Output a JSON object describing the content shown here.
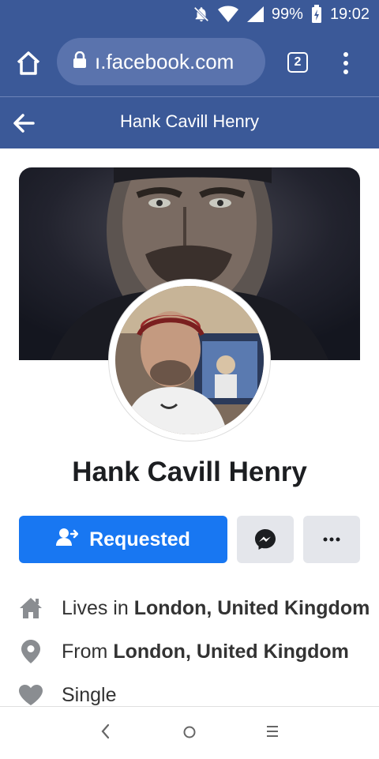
{
  "status": {
    "battery": "99%",
    "time": "19:02"
  },
  "browser": {
    "url": "ı.facebook.com",
    "tab_count": "2"
  },
  "header": {
    "title": "Hank Cavill Henry"
  },
  "profile": {
    "name": "Hank Cavill Henry",
    "requested_label": "Requested",
    "more_label": "•••"
  },
  "info": [
    {
      "prefix": "Lives in ",
      "value": "London, United Kingdom",
      "icon": "home-icon"
    },
    {
      "prefix": "From ",
      "value": "London, United Kingdom",
      "icon": "location-pin-icon"
    },
    {
      "prefix": "Single",
      "value": "",
      "icon": "heart-icon"
    }
  ],
  "colors": {
    "facebook_blue": "#3b5998",
    "button_blue": "#1877f2",
    "button_grey": "#e4e6eb"
  }
}
